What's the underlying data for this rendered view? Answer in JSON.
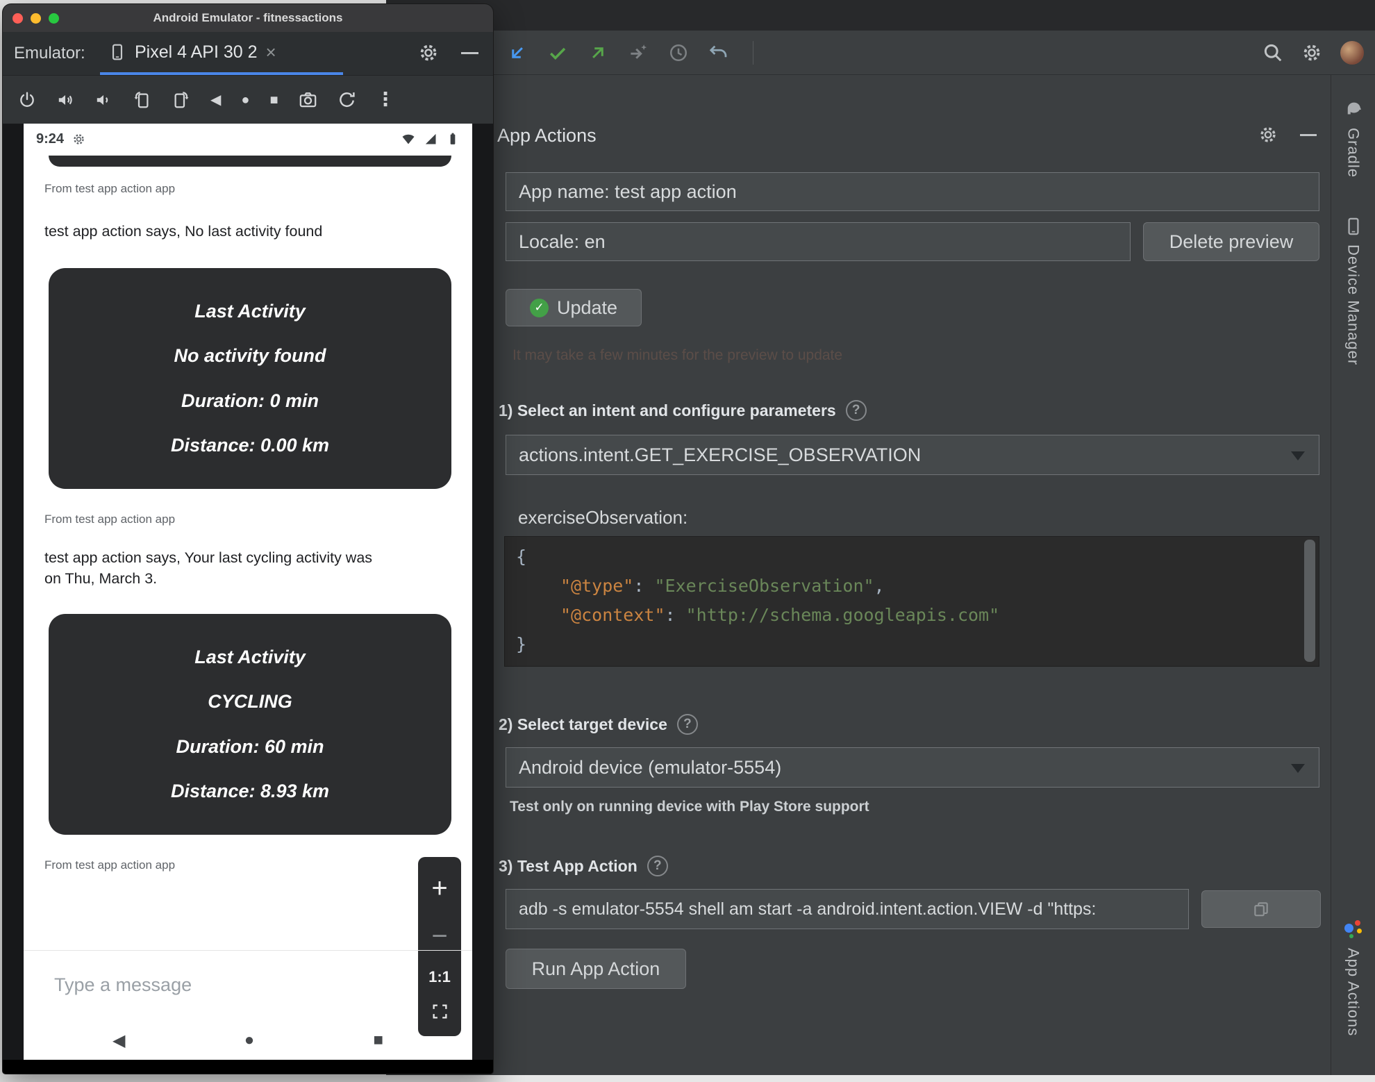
{
  "colors": {
    "accent_blue": "#4a86e8",
    "traffic_red": "#ff5f57",
    "traffic_yellow": "#febc2e",
    "traffic_green": "#28c840",
    "success_green": "#43a047",
    "code_key": "#cb8441",
    "code_string": "#6a8759"
  },
  "icons": {
    "back_glyph": "◀",
    "home_glyph": "●",
    "overview_glyph": "■",
    "kebab_glyph": "⋮",
    "close_glyph": "×",
    "help_glyph": "?",
    "check_glyph": "✓",
    "caret_down_glyph": "▼",
    "zoom_in_glyph": "+",
    "zoom_out_glyph": "−",
    "zoom_ratio": "1:1"
  },
  "emulator": {
    "window_title": "Android Emulator - fitnessactions",
    "tabbar": {
      "emulator_label": "Emulator:",
      "tab_label": "Pixel 4 API 30 2"
    },
    "phone": {
      "status_time": "9:24",
      "chat": {
        "sender1": "From test app action app",
        "message1": "test app action says, No last activity found",
        "card1": {
          "title": "Last Activity",
          "line2": "No activity found",
          "line3": "Duration: 0 min",
          "line4": "Distance: 0.00 km"
        },
        "sender2": "From test app action app",
        "message2": "test app action says, Your last cycling activity was on Thu, March 3.",
        "card2": {
          "title": "Last Activity",
          "line2": "CYCLING",
          "line3": "Duration: 60 min",
          "line4": "Distance: 8.93 km"
        },
        "sender3": "From test app action app"
      },
      "input_placeholder": "Type a message"
    }
  },
  "studio": {
    "panel": {
      "title": "App Actions",
      "app_name_value": "App name: test app action",
      "locale_value": "Locale: en",
      "delete_preview_label": "Delete preview",
      "update_label": "Update",
      "faded_note": "It may take a few minutes for the preview to update",
      "section1_label": "1) Select an intent and configure parameters",
      "intent_value": "actions.intent.GET_EXERCISE_OBSERVATION",
      "param_name": "exerciseObservation:",
      "code": {
        "line1": "{",
        "line2_key": "\"@type\"",
        "line2_colon": ": ",
        "line2_value": "\"ExerciseObservation\"",
        "line2_comma": ",",
        "line3_key": "\"@context\"",
        "line3_colon": ": ",
        "line3_value": "\"http://schema.googleapis.com\"",
        "line4": "}"
      },
      "section2_label": "2) Select target device",
      "device_value": "Android device (emulator-5554)",
      "device_note": "Test only on running device with Play Store support",
      "section3_label": "3) Test App Action",
      "adb_command": "adb -s emulator-5554 shell am start -a android.intent.action.VIEW -d \"https:",
      "run_label": "Run App Action"
    },
    "stripe": {
      "gradle": "Gradle",
      "device_manager": "Device Manager",
      "app_actions": "App Actions"
    }
  }
}
